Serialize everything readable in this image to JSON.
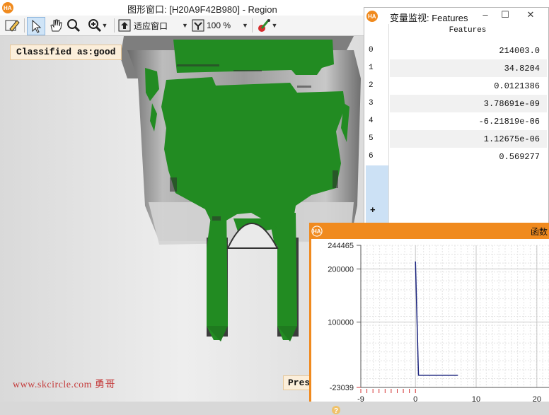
{
  "main_window": {
    "title": "图形窗口: [H20A9F42B980] - Region",
    "toolbar": {
      "fit_label": "适应窗口",
      "zoom_value": "100 %"
    }
  },
  "canvas": {
    "classified_label": "Classified as:good",
    "watermark": "www.skcircle.com 勇哥",
    "press_label": "Pres"
  },
  "variable_monitor": {
    "title": "变量监视: Features",
    "column_header": "Features",
    "rows": [
      {
        "index": "0",
        "value": "214003.0"
      },
      {
        "index": "1",
        "value": "34.8204"
      },
      {
        "index": "2",
        "value": "0.0121386"
      },
      {
        "index": "3",
        "value": "3.78691e-09"
      },
      {
        "index": "4",
        "value": "-6.21819e-06"
      },
      {
        "index": "5",
        "value": "1.12675e-06"
      },
      {
        "index": "6",
        "value": "0.569277"
      }
    ],
    "add_row_label": "+"
  },
  "function_window": {
    "title": "函数",
    "y_tick_labels": [
      "244465",
      "200000",
      "100000",
      "-23039"
    ],
    "x_tick_labels": [
      "-9",
      "0",
      "10",
      "20"
    ]
  },
  "chart_data": {
    "type": "line",
    "series": [
      {
        "values_x": [
          0,
          0,
          0.5,
          7
        ],
        "values_y": [
          214003,
          214003,
          0,
          0
        ]
      }
    ],
    "x": [
      0,
      0.5,
      7
    ],
    "ylim": [
      -23039,
      244465
    ],
    "xlim": [
      -9,
      22
    ],
    "grid": true
  },
  "colors": {
    "region_green": "#228b22",
    "accent_orange": "#f08a1e",
    "plot_line": "#1a237e",
    "selection_blue": "#cce1f5"
  },
  "icons": [
    "halcon-logo-icon",
    "pencil-icon",
    "pointer-icon",
    "hand-icon",
    "magnifier-icon",
    "zoom-in-icon",
    "fit-window-icon",
    "zoom-percent-icon",
    "color-picker-icon",
    "minimize-icon",
    "maximize-icon",
    "close-icon",
    "help-icon"
  ]
}
